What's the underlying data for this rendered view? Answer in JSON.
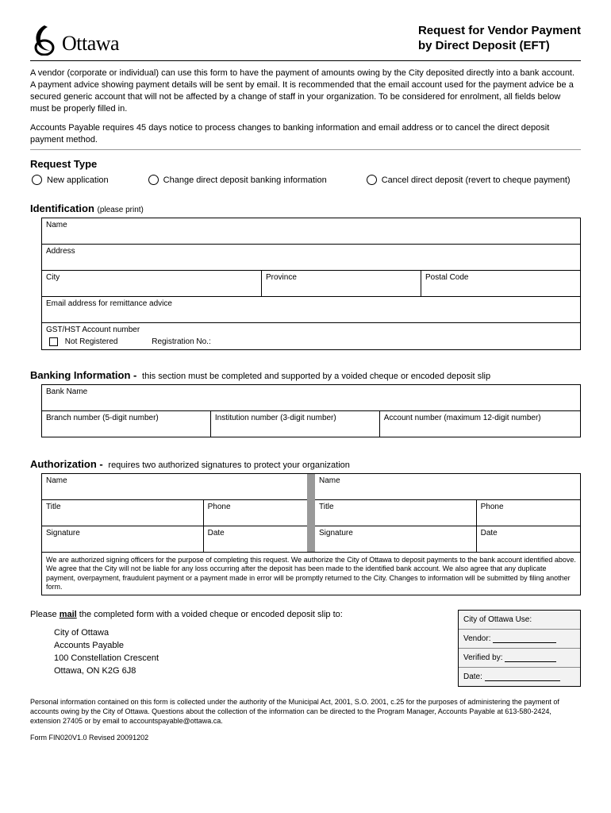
{
  "header": {
    "logo_text": "Ottawa",
    "title_line1": "Request for Vendor Payment",
    "title_line2": "by Direct Deposit (EFT)"
  },
  "intro_p1": "A vendor (corporate or individual) can use this form to have the payment of amounts owing by the City deposited directly into a bank account. A payment advice showing payment details will be sent by email. It is recommended that the email account used for the payment advice be a secured generic account that will not be affected by a change of staff in your organization. To be considered for enrolment, all fields below must be properly filled in.",
  "intro_p2": "Accounts Payable requires 45 days notice to process changes to banking information and email address or to cancel the direct deposit payment method.",
  "request_type": {
    "heading": "Request Type",
    "options": {
      "new": "New application",
      "change": "Change direct deposit banking information",
      "cancel": "Cancel direct deposit (revert to cheque payment)"
    }
  },
  "identification": {
    "heading": "Identification",
    "sub": "(please print)",
    "fields": {
      "name": "Name",
      "address": "Address",
      "city": "City",
      "province": "Province",
      "postal": "Postal Code",
      "email": "Email address for remittance advice",
      "gst_label": "GST/HST Account number",
      "not_registered": "Not Registered",
      "reg_no": "Registration No.:"
    }
  },
  "banking": {
    "heading": "Banking Information -",
    "sub": "this section must be completed and supported by a voided cheque or encoded deposit slip",
    "fields": {
      "bank_name": "Bank Name",
      "branch": "Branch number (5-digit number)",
      "institution": "Institution number (3-digit number)",
      "account": "Account number (maximum 12-digit number)"
    }
  },
  "authorization": {
    "heading": "Authorization -",
    "sub": "requires two authorized signatures to protect your organization",
    "fields": {
      "name": "Name",
      "title": "Title",
      "phone": "Phone",
      "signature": "Signature",
      "date": "Date"
    },
    "disclaimer": "We are authorized signing officers for the purpose of completing this request. We authorize the City of Ottawa to deposit payments to the bank account identified above. We agree that the City will not be liable for any loss occurring after the deposit has been made to the identified bank account. We also agree that any duplicate payment, overpayment, fraudulent payment or a payment made in error will be promptly returned to the City. Changes to information will be submitted by filing another form."
  },
  "mail": {
    "instruction_pre": "Please ",
    "instruction_bold": "mail",
    "instruction_post": " the completed form with a voided cheque or encoded deposit slip to:",
    "address": {
      "l1": "City of Ottawa",
      "l2": "Accounts Payable",
      "l3": "100 Constellation Crescent",
      "l4": "Ottawa, ON K2G 6J8"
    }
  },
  "city_use": {
    "heading": "City of Ottawa Use:",
    "vendor": "Vendor:",
    "verified": "Verified by:",
    "date": "Date:"
  },
  "footer": "Personal information contained on this form is collected under the authority of the Municipal Act, 2001, S.O. 2001, c.25 for the purposes of administering the payment of accounts owing by the City of Ottawa. Questions about the collection of the information can be directed to the Program Manager, Accounts Payable at 613-580-2424, extension 27405 or by email to accountspayable@ottawa.ca.",
  "form_id": "Form FIN020V1.0 Revised 20091202"
}
